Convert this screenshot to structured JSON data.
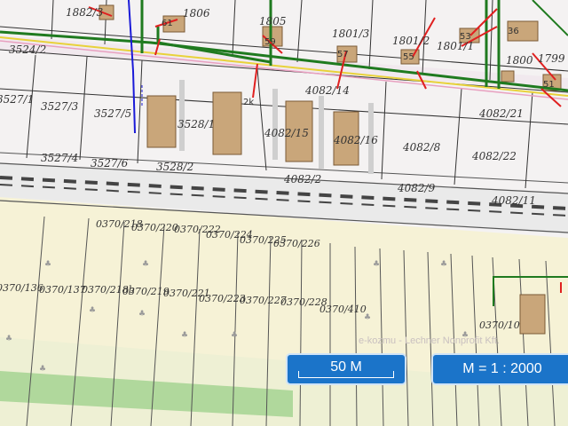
{
  "map": {
    "parcels": [
      "1882/3",
      "1806",
      "1805",
      "1801/3",
      "1801/2",
      "1801/1",
      "1800",
      "1799",
      "3524/2",
      "3527/1",
      "3527/3",
      "3527/5",
      "3528/1",
      "4082/15",
      "4082/16",
      "4082/14",
      "4082/8",
      "4082/22",
      "4082/21",
      "3527/4",
      "3527/6",
      "3528/2",
      "4082/2",
      "4082/9",
      "4082/11",
      "0370/218",
      "0370/220",
      "0370/222",
      "0370/224",
      "0370/225",
      "0370/226",
      "0370/136",
      "0370/137",
      "0370/218b",
      "0370/219",
      "0370/221",
      "0370/223",
      "0370/227",
      "0370/228",
      "0370/410",
      "0370/10"
    ],
    "house_numbers": [
      "61",
      "59",
      "57",
      "55",
      "53",
      "51",
      "36",
      "2k"
    ],
    "watermark": "e-kozmu - Lechner Nonprofit Kft."
  },
  "controls": {
    "scale_label": "50 M",
    "ratio_label": "M = 1 : 2000"
  },
  "colors": {
    "accent": "#1b74c9",
    "utility_green": "#1f7a1f",
    "utility_red": "#e02020",
    "utility_blue": "#1a1ad8",
    "utility_yellow": "#e8d23a",
    "field": "#f4f0d4",
    "building": "#c9a67a"
  }
}
